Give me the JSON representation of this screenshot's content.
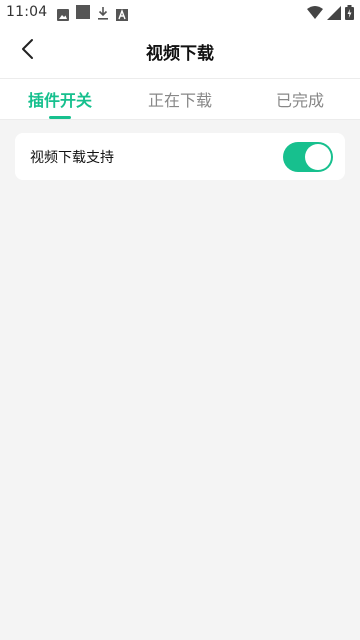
{
  "status_bar": {
    "time": "11:04",
    "icons": [
      "image-icon",
      "square-icon",
      "download-icon",
      "a-icon",
      "wifi-icon",
      "signal-icon",
      "battery-icon"
    ]
  },
  "header": {
    "title": "视频下载",
    "back_icon": "chevron-left-icon"
  },
  "tabs": [
    {
      "label": "插件开关",
      "active": true
    },
    {
      "label": "正在下载",
      "active": false
    },
    {
      "label": "已完成",
      "active": false
    }
  ],
  "settings": {
    "video_download_label": "视频下载支持",
    "video_download_enabled": true
  },
  "colors": {
    "accent": "#17c08e",
    "background": "#f4f4f4",
    "card": "#ffffff"
  }
}
